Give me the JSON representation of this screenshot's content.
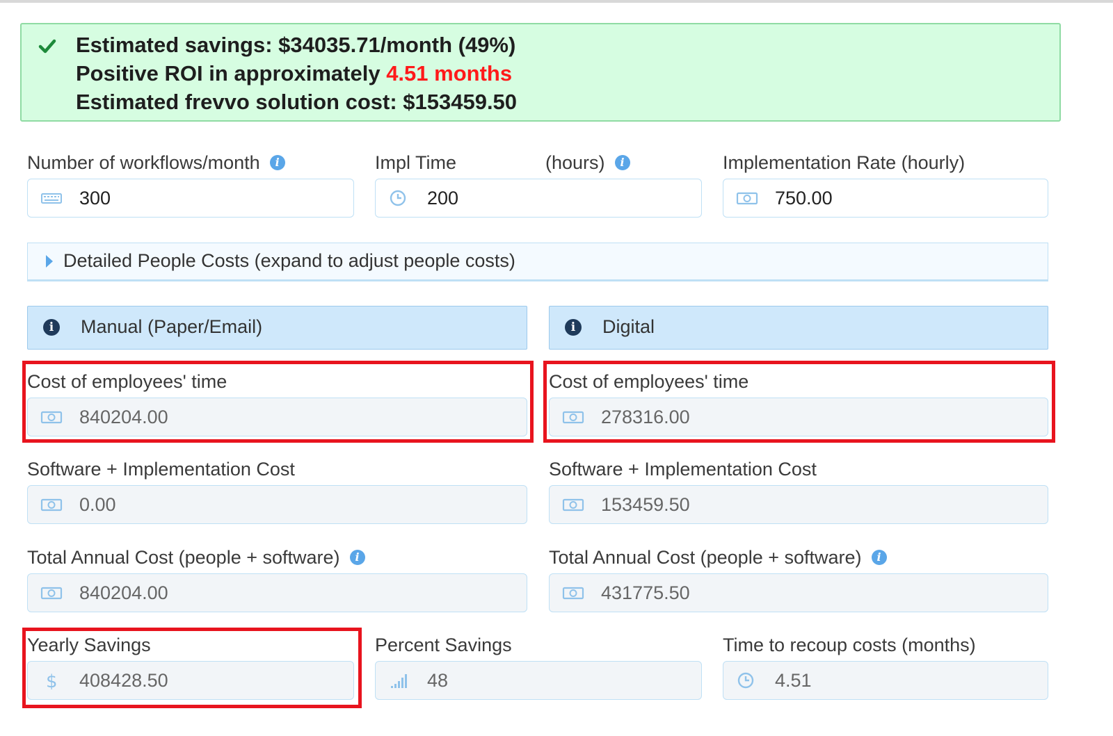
{
  "alert": {
    "line1": "Estimated savings: $34035.71/month (49%)",
    "line2_prefix": "Positive ROI in approximately ",
    "line2_highlight": "4.51 months",
    "line3": "Estimated frevvo solution cost: $153459.50"
  },
  "inputs": {
    "workflows": {
      "label": "Number of workflows/month",
      "value": "300",
      "icon": "keyboard-icon"
    },
    "impl_time": {
      "label": "Impl Time",
      "label_suffix": "(hours)",
      "value": "200",
      "icon": "clock-icon"
    },
    "impl_rate": {
      "label": "Implementation Rate (hourly)",
      "value": "750.00",
      "icon": "money-icon"
    }
  },
  "collapse": {
    "label": "Detailed People Costs (expand to adjust people costs)"
  },
  "manual": {
    "header": "Manual (Paper/Email)",
    "employee_cost_label": "Cost of employees' time",
    "employee_cost": "840204.00",
    "software_label": "Software + Implementation Cost",
    "software_cost": "0.00",
    "total_label": "Total Annual Cost (people + software)",
    "total_cost": "840204.00"
  },
  "digital": {
    "header": "Digital",
    "employee_cost_label": "Cost of employees' time",
    "employee_cost": "278316.00",
    "software_label": "Software + Implementation Cost",
    "software_cost": "153459.50",
    "total_label": "Total Annual Cost (people + software)",
    "total_cost": "431775.50"
  },
  "results": {
    "yearly_label": "Yearly Savings",
    "yearly_value": "408428.50",
    "percent_label": "Percent Savings",
    "percent_value": "48",
    "recoup_label": "Time to recoup costs (months)",
    "recoup_value": "4.51"
  },
  "colors": {
    "accent": "#5aa6e8",
    "highlight": "#e8141e",
    "alert_bg": "#d6fde1",
    "roi_red": "#ff1a1a"
  }
}
